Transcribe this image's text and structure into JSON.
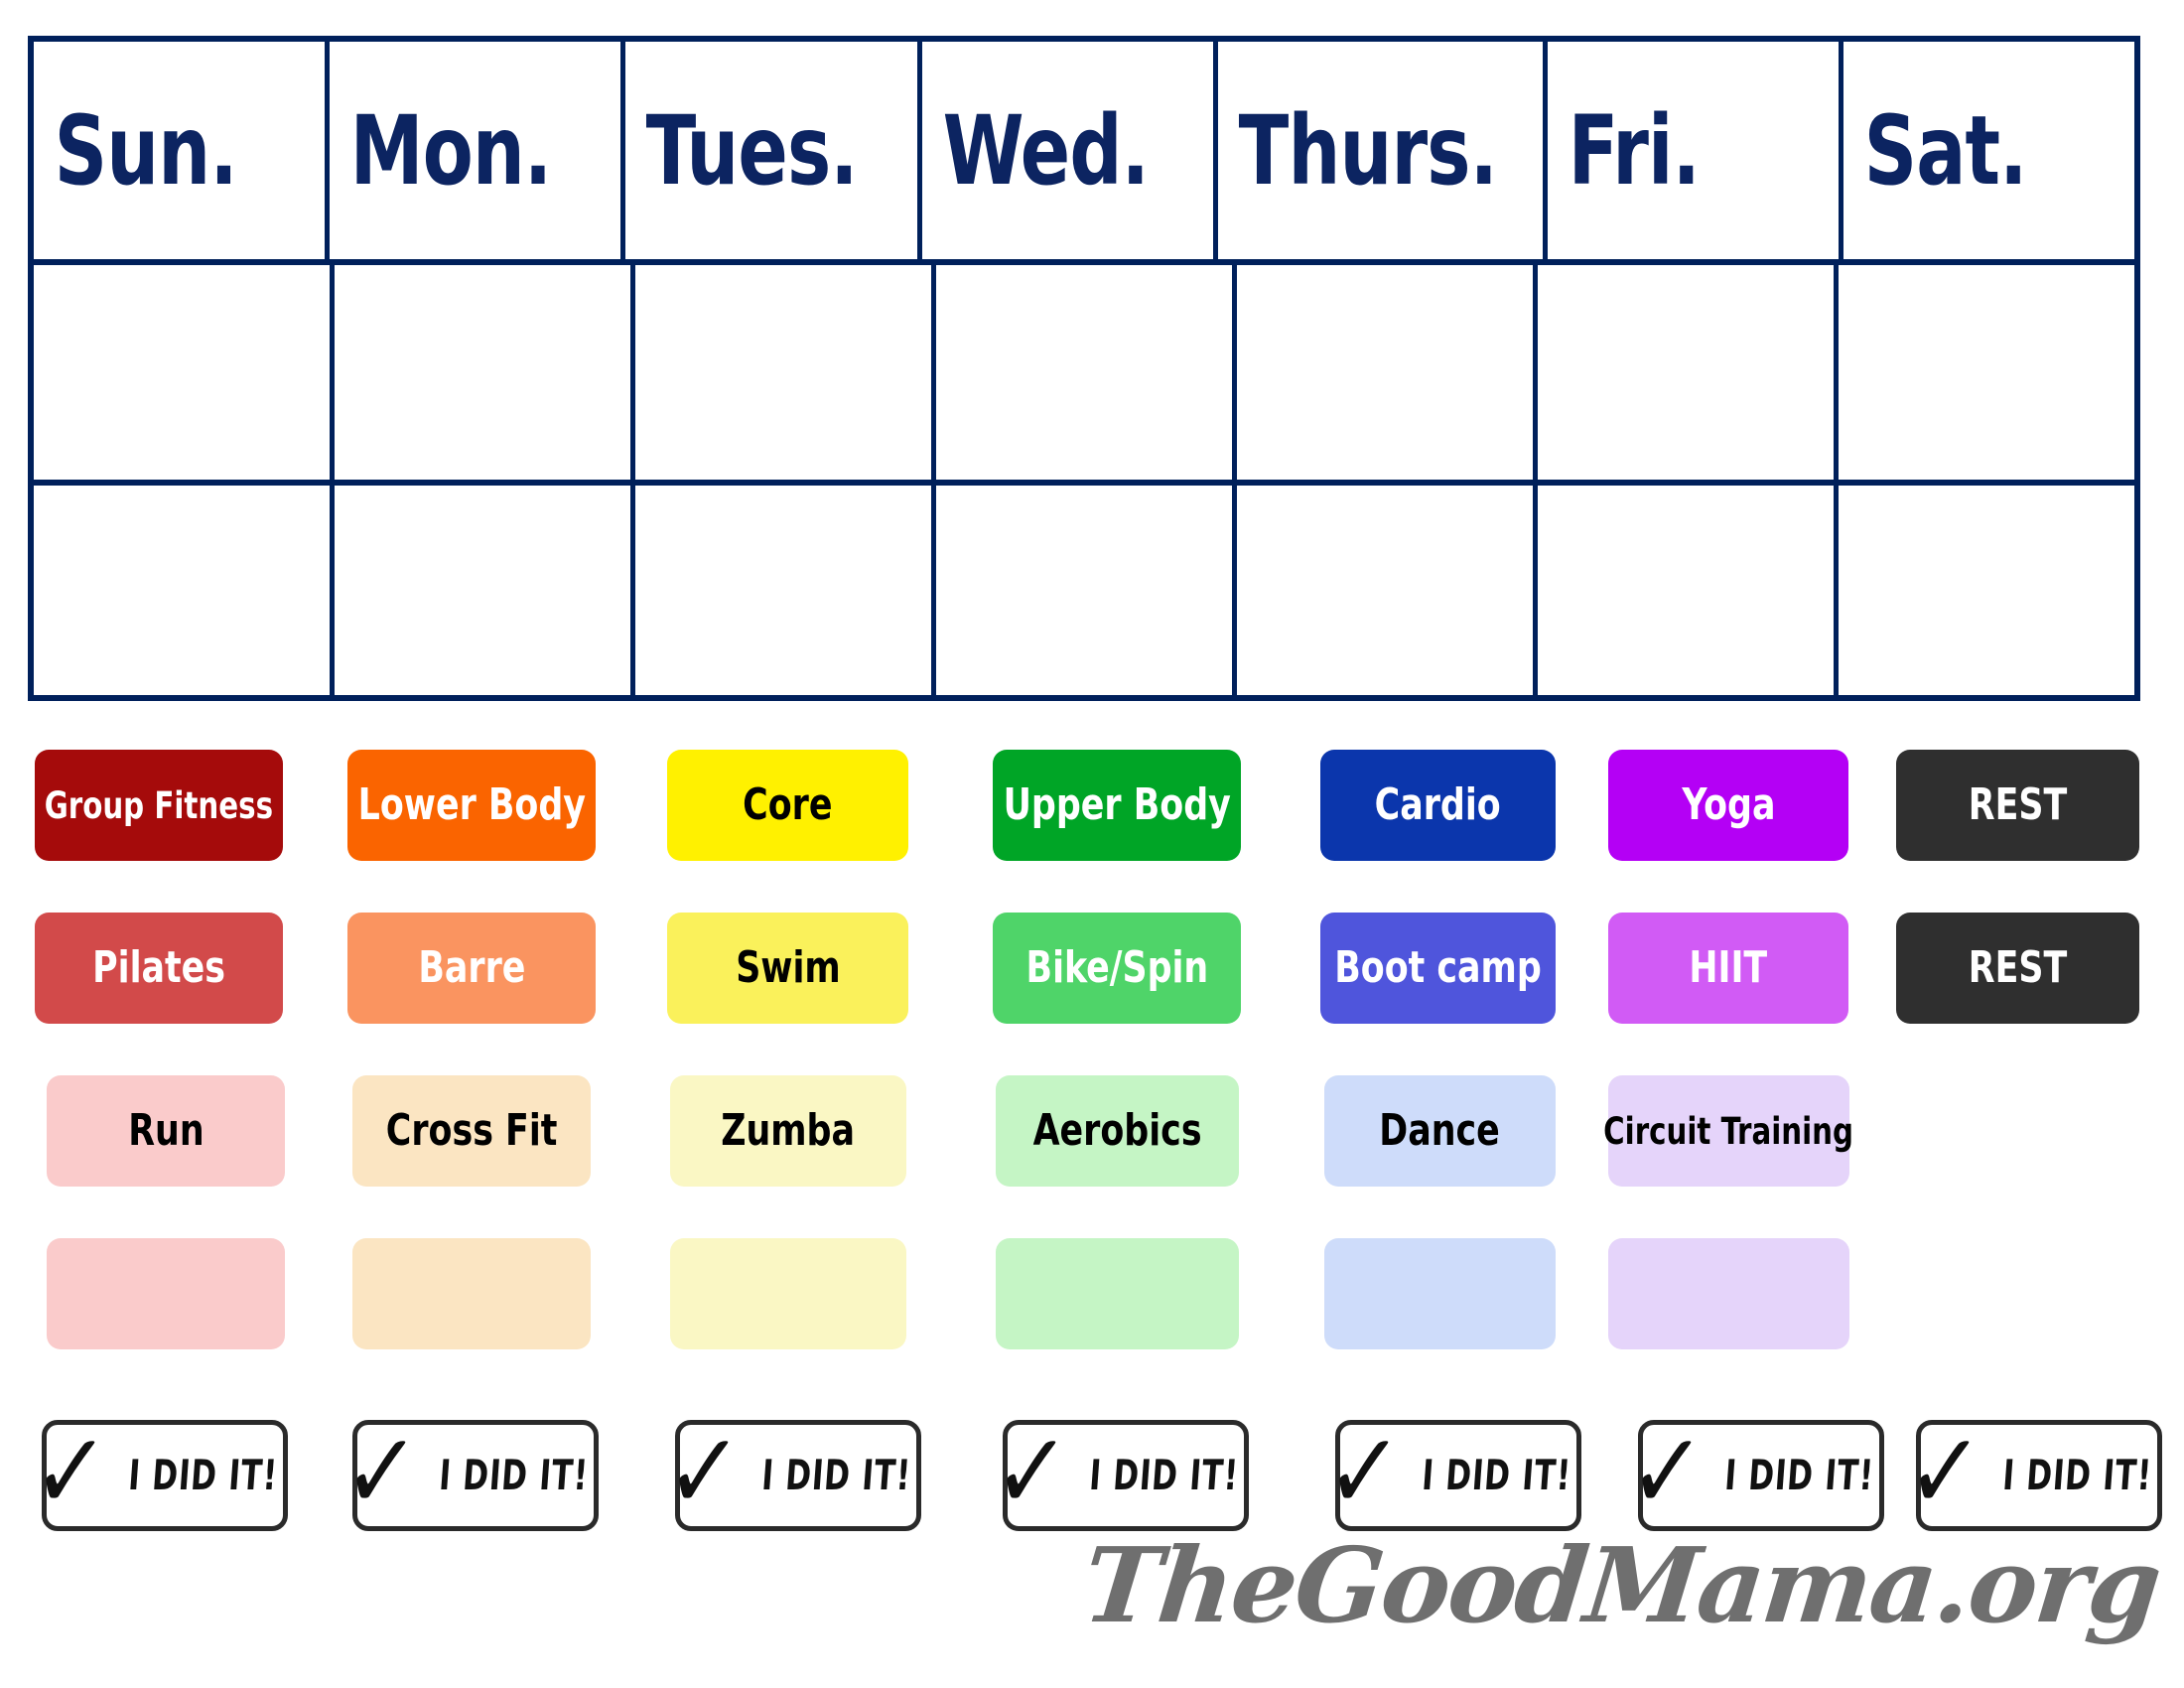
{
  "calendar": {
    "days": [
      "Sun.",
      "Mon.",
      "Tues.",
      "Wed.",
      "Thurs.",
      "Fri.",
      "Sat."
    ],
    "blank_rows": 2,
    "border_color": "#00205B",
    "header_text_color": "#0C2461"
  },
  "legend": {
    "rows": [
      {
        "chips": [
          {
            "label": "Group Fitness",
            "bg": "#A50B0B",
            "fg": "#FFFFFF",
            "size": "small"
          },
          {
            "label": "Lower Body",
            "bg": "#FA6400",
            "fg": "#FFFFFF",
            "size": "normal"
          },
          {
            "label": "Core",
            "bg": "#FFF100",
            "fg": "#000000",
            "size": "normal"
          },
          {
            "label": "Upper Body",
            "bg": "#00A526",
            "fg": "#FFFFFF",
            "size": "normal"
          },
          {
            "label": "Cardio",
            "bg": "#0B36AC",
            "fg": "#FFFFFF",
            "size": "normal"
          },
          {
            "label": "Yoga",
            "bg": "#B400F5",
            "fg": "#FFFFFF",
            "size": "normal"
          },
          {
            "label": "REST",
            "bg": "#2F2F2F",
            "fg": "#FFFFFF",
            "size": "normal"
          }
        ]
      },
      {
        "chips": [
          {
            "label": "Pilates",
            "bg": "#D24A4A",
            "fg": "#FFFFFF",
            "size": "normal"
          },
          {
            "label": "Barre",
            "bg": "#FA9460",
            "fg": "#FFFFFF",
            "size": "normal"
          },
          {
            "label": "Swim",
            "bg": "#FAF15B",
            "fg": "#000000",
            "size": "normal"
          },
          {
            "label": "Bike/Spin",
            "bg": "#4FD469",
            "fg": "#FFFFFF",
            "size": "normal"
          },
          {
            "label": "Boot camp",
            "bg": "#4F55DC",
            "fg": "#FFFFFF",
            "size": "normal"
          },
          {
            "label": "HIIT",
            "bg": "#D15BF5",
            "fg": "#FFFFFF",
            "size": "normal"
          },
          {
            "label": "REST",
            "bg": "#2F2F2F",
            "fg": "#FFFFFF",
            "size": "normal"
          }
        ]
      },
      {
        "chips": [
          {
            "label": "Run",
            "bg": "#FACBCB",
            "fg": "#000000",
            "size": "normal"
          },
          {
            "label": "Cross Fit",
            "bg": "#FBE5C2",
            "fg": "#000000",
            "size": "normal"
          },
          {
            "label": "Zumba",
            "bg": "#FAF7C4",
            "fg": "#000000",
            "size": "normal"
          },
          {
            "label": "Aerobics",
            "bg": "#C5F5C5",
            "fg": "#000000",
            "size": "normal"
          },
          {
            "label": "Dance",
            "bg": "#CEDCFA",
            "fg": "#000000",
            "size": "normal"
          },
          {
            "label": "Circuit Training",
            "bg": "#E5D4FA",
            "fg": "#000000",
            "size": "small"
          }
        ]
      },
      {
        "chips": [
          {
            "label": "",
            "bg": "#FACBCB",
            "fg": "#000000",
            "size": "normal"
          },
          {
            "label": "",
            "bg": "#FBE5C2",
            "fg": "#000000",
            "size": "normal"
          },
          {
            "label": "",
            "bg": "#FAF7C4",
            "fg": "#000000",
            "size": "normal"
          },
          {
            "label": "",
            "bg": "#C5F5C5",
            "fg": "#000000",
            "size": "normal"
          },
          {
            "label": "",
            "bg": "#CEDCFA",
            "fg": "#000000",
            "size": "normal"
          },
          {
            "label": "",
            "bg": "#E5D4FA",
            "fg": "#000000",
            "size": "normal"
          }
        ]
      }
    ]
  },
  "checkboxes": {
    "count": 7,
    "label": "I DID IT!",
    "check_glyph": "✓",
    "border_color": "#2A2A2A"
  },
  "footer": {
    "logo_text": "TheGoodMama.org",
    "logo_color": "#6F6F6F"
  }
}
